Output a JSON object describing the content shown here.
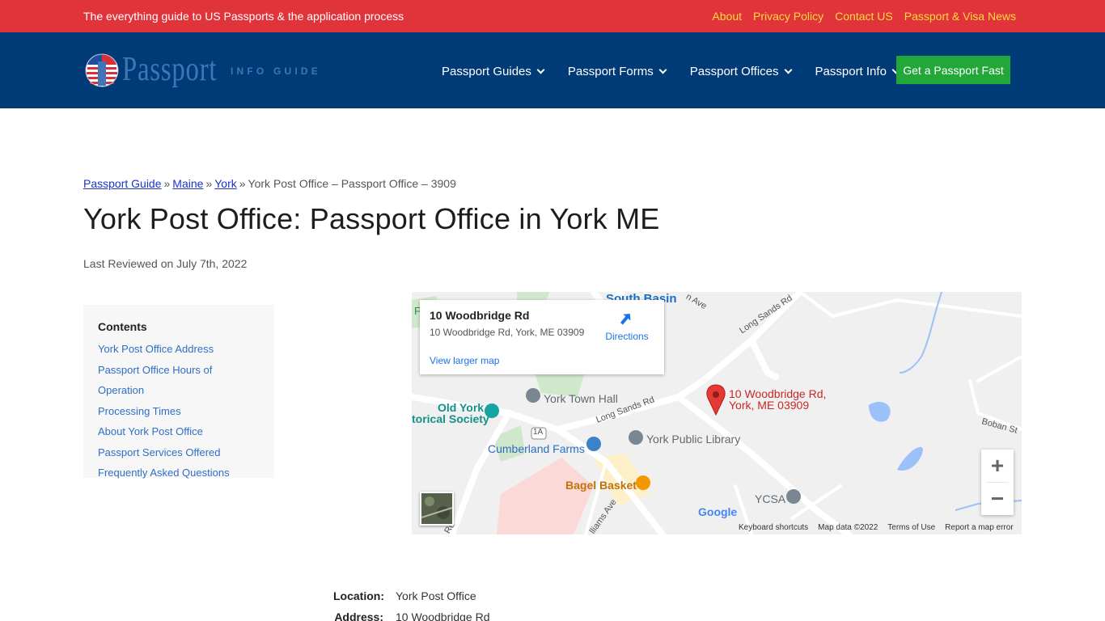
{
  "topbar": {
    "tagline": "The everything guide to US Passports & the application process",
    "links": [
      "About",
      "Privacy Policy",
      "Contact US",
      "Passport & Visa News"
    ]
  },
  "logo": {
    "word": "Passport",
    "sub": "INFO GUIDE"
  },
  "nav": {
    "items": [
      "Passport Guides",
      "Passport Forms",
      "Passport Offices",
      "Passport Info"
    ],
    "cta": "Get a Passport Fast"
  },
  "breadcrumb": {
    "links": [
      "Passport Guide",
      "Maine",
      "York"
    ],
    "separator": "»",
    "current": "York Post Office – Passport Office – 3909"
  },
  "page": {
    "title": "York Post Office: Passport Office in York ME",
    "reviewed": "Last Reviewed on July 7th, 2022"
  },
  "toc": {
    "title": "Contents",
    "items": [
      "York Post Office Address",
      "Passport Office Hours of Operation",
      "Processing Times",
      "About York Post Office",
      "Passport Services Offered",
      "Frequently Asked Questions"
    ]
  },
  "map": {
    "card_title": "10 Woodbridge Rd",
    "card_address": "10 Woodbridge Rd, York, ME 03909",
    "directions": "Directions",
    "view_larger": "View larger map",
    "pin_label_line1": "10 Woodbridge Rd,",
    "pin_label_line2": "York, ME 03909",
    "places": {
      "south_basin": "South Basin",
      "old_york_1": "Old York",
      "old_york_2": "torical Society",
      "town_hall": "York Town Hall",
      "cumberland": "Cumberland Farms",
      "library": "York Public Library",
      "bagel": "Bagel Basket",
      "ycsa": "YCSA",
      "long_sands_1": "Long Sands Rd",
      "long_sands_2": "Long Sands Rd",
      "boban": "Boban St",
      "williams": "lliams Ave",
      "rd": "Rd",
      "route": "1A",
      "f": "F",
      "n_ave": "n Ave"
    },
    "google": "Google",
    "attribution": [
      "Keyboard shortcuts",
      "Map data ©2022",
      "Terms of Use",
      "Report a map error"
    ],
    "zoom_in": "+",
    "zoom_out": "−"
  },
  "details": {
    "location_label": "Location:",
    "location_value": "York Post Office",
    "address_label": "Address:",
    "address_value": "10 Woodbridge Rd"
  }
}
